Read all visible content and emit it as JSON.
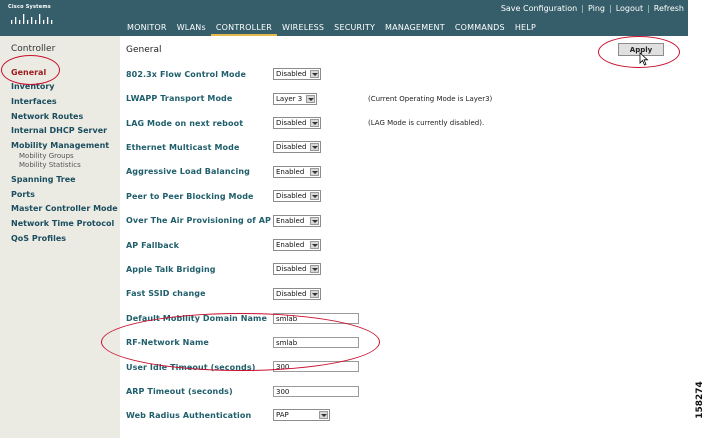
{
  "brand": {
    "logo_text": "Cisco Systems"
  },
  "util_links": [
    "Save Configuration",
    "Ping",
    "Logout",
    "Refresh"
  ],
  "nav": [
    "MONITOR",
    "WLANs",
    "CONTROLLER",
    "WIRELESS",
    "SECURITY",
    "MANAGEMENT",
    "COMMANDS",
    "HELP"
  ],
  "nav_active": "CONTROLLER",
  "sidebar": {
    "title": "Controller",
    "items": [
      {
        "label": "General",
        "active": true
      },
      {
        "label": "Inventory"
      },
      {
        "label": "Interfaces"
      },
      {
        "label": "Network Routes"
      },
      {
        "label": "Internal DHCP Server"
      },
      {
        "label": "Mobility Management"
      },
      {
        "label": "Spanning Tree"
      },
      {
        "label": "Ports"
      },
      {
        "label": "Master Controller Mode"
      },
      {
        "label": "Network Time Protocol"
      },
      {
        "label": "QoS Profiles"
      }
    ],
    "subitems": [
      "Mobility Groups",
      "Mobility Statistics"
    ]
  },
  "main": {
    "title": "General",
    "apply_label": "Apply",
    "rows": [
      {
        "label": "802.3x Flow Control Mode",
        "type": "select",
        "value": "Disabled"
      },
      {
        "label": "LWAPP Transport Mode",
        "type": "select",
        "value": "Layer 3",
        "note": "(Current Operating Mode is Layer3)"
      },
      {
        "label": "LAG Mode on next reboot",
        "type": "select",
        "value": "Disabled",
        "note": "(LAG Mode is currently disabled)."
      },
      {
        "label": "Ethernet Multicast Mode",
        "type": "select",
        "value": "Disabled"
      },
      {
        "label": "Aggressive Load Balancing",
        "type": "select",
        "value": "Enabled"
      },
      {
        "label": "Peer to Peer Blocking Mode",
        "type": "select",
        "value": "Disabled"
      },
      {
        "label": "Over The Air Provisioning of AP",
        "type": "select",
        "value": "Enabled"
      },
      {
        "label": "AP Fallback",
        "type": "select",
        "value": "Enabled"
      },
      {
        "label": "Apple Talk Bridging",
        "type": "select",
        "value": "Disabled"
      },
      {
        "label": "Fast SSID change",
        "type": "select",
        "value": "Disabled"
      },
      {
        "label": "Default Mobility Domain Name",
        "type": "text",
        "value": "smlab"
      },
      {
        "label": "RF-Network Name",
        "type": "text",
        "value": "smlab"
      },
      {
        "label": "User Idle Timeout (seconds)",
        "type": "text",
        "value": "300"
      },
      {
        "label": "ARP Timeout (seconds)",
        "type": "text",
        "value": "300"
      },
      {
        "label": "Web Radius Authentication",
        "type": "select",
        "value": "PAP"
      }
    ]
  },
  "figure_number": "158274",
  "colors": {
    "banner": "#355e6a",
    "nav_active_underline": "#e5b84b",
    "sidebar_bg": "#ebebe4",
    "label_teal": "#1f5e6b",
    "highlight_red": "#c8102e"
  }
}
